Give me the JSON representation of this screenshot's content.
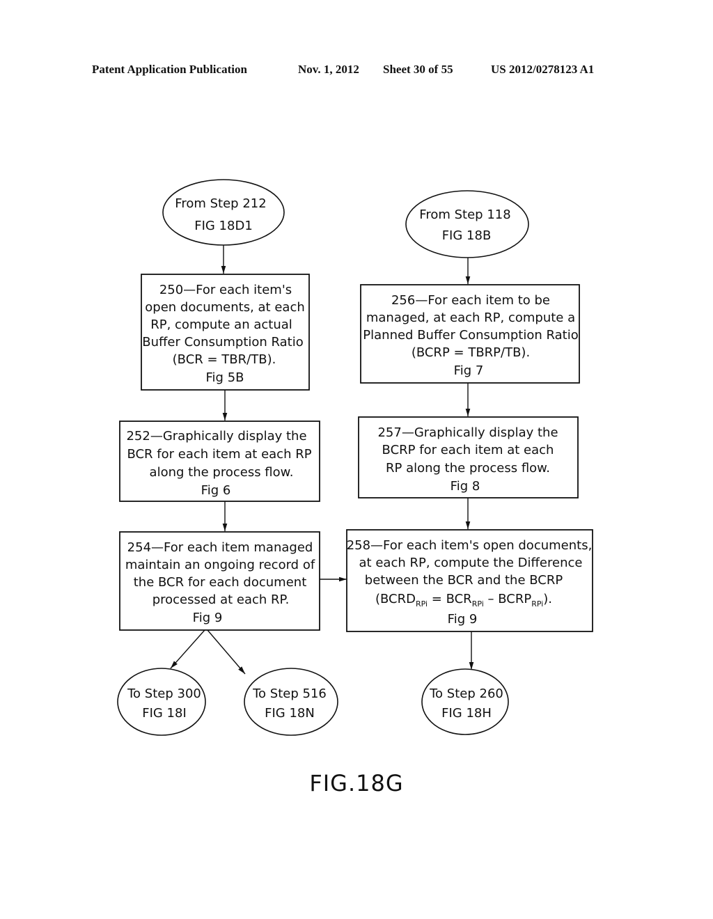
{
  "header": {
    "publication": "Patent Application Publication",
    "date": "Nov. 1, 2012",
    "sheet": "Sheet 30 of 55",
    "number": "US 2012/0278123 A1"
  },
  "figure_label": "FIG.18G",
  "connectors_in": [
    {
      "id": "from-212",
      "lines": [
        "From Step 212",
        "FIG 18D1"
      ]
    },
    {
      "id": "from-118",
      "lines": [
        "From Step 118",
        "FIG 18B"
      ]
    }
  ],
  "steps": [
    {
      "id": "250",
      "lines": [
        "250—For each item's",
        "open documents, at each",
        "RP, compute an actual",
        "Buffer Consumption Ratio",
        "(BCR = TBR/TB).",
        "Fig 5B"
      ]
    },
    {
      "id": "252",
      "lines": [
        "252—Graphically display the",
        "BCR for each item at each RP",
        "along the process flow.",
        "Fig 6"
      ]
    },
    {
      "id": "254",
      "lines": [
        "254—For each item managed",
        "maintain an ongoing record of",
        "the BCR for each document",
        "processed at each RP.",
        "Fig 9"
      ]
    },
    {
      "id": "256",
      "lines": [
        "256—For each item to be",
        "managed, at each RP, compute a",
        "Planned Buffer Consumption Ratio",
        "(BCRP = TBRP/TB).",
        "Fig 7"
      ]
    },
    {
      "id": "257",
      "lines": [
        "257—Graphically display the",
        "BCRP for each item at each",
        "RP along the process flow.",
        "Fig 8"
      ]
    },
    {
      "id": "258",
      "lines": [
        "258—For each item's open documents,",
        "at each RP, compute the Difference",
        "between the BCR and the BCRP"
      ],
      "formula": {
        "open": "(BCRD",
        "sub1": "RPi",
        "eq": " = BCR",
        "sub2": "RPi",
        "minus": " – BCRP",
        "sub3": "RPi",
        "close": ")."
      },
      "fig": "Fig 9"
    }
  ],
  "connectors_out": [
    {
      "id": "to-300",
      "lines": [
        "To Step 300",
        "FIG 18I"
      ]
    },
    {
      "id": "to-516",
      "lines": [
        "To Step 516",
        "FIG 18N"
      ]
    },
    {
      "id": "to-260",
      "lines": [
        "To Step 260",
        "FIG 18H"
      ]
    }
  ]
}
